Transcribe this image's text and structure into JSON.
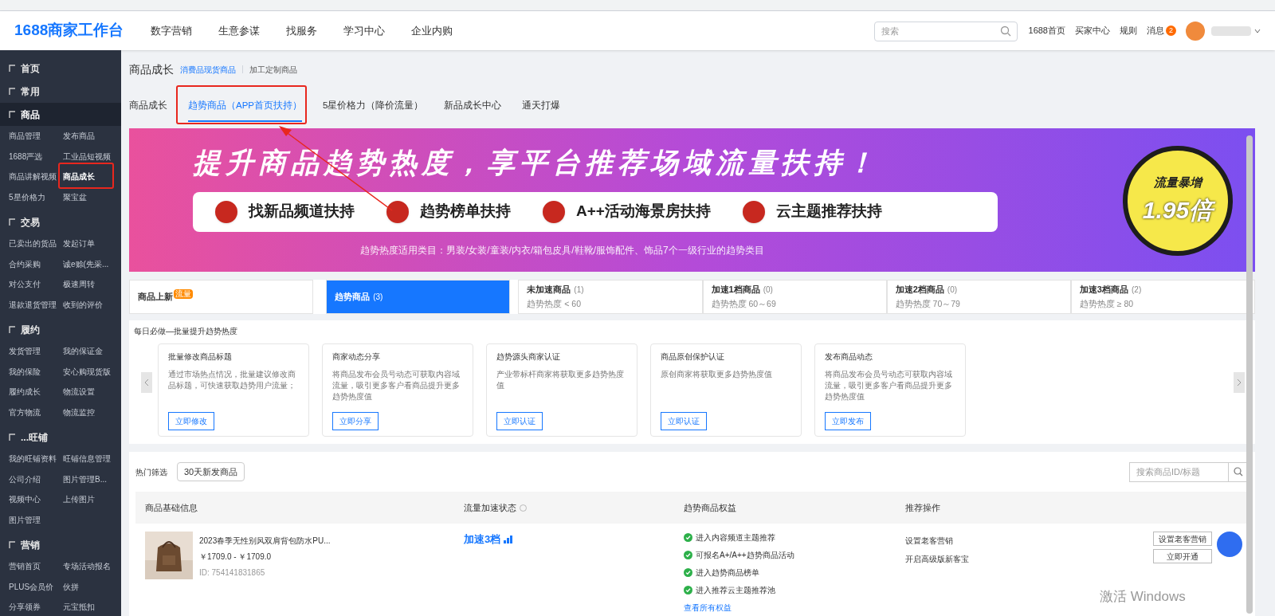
{
  "header": {
    "logo": "1688商家工作台",
    "nav": [
      "数字营销",
      "生意参谋",
      "找服务",
      "学习中心",
      "企业内购"
    ],
    "search": {
      "placeholder": "搜索"
    },
    "links": [
      "1688首页",
      "买家中心",
      "规则"
    ],
    "messages": {
      "label": "消息",
      "count": "2"
    }
  },
  "sidebar": {
    "sections": [
      {
        "title": "首页",
        "selected": false
      },
      {
        "title": "常用",
        "selected": false
      },
      {
        "title": "商品",
        "selected": true,
        "items": [
          {
            "label": "商品管理",
            "selected": false
          },
          {
            "label": "发布商品",
            "selected": false
          },
          {
            "label": "1688严选",
            "selected": false
          },
          {
            "label": "工业品短视频",
            "selected": false
          },
          {
            "label": "商品讲解视频",
            "selected": false
          },
          {
            "label": "商品成长",
            "selected": true
          },
          {
            "label": "5星价格力",
            "selected": false
          },
          {
            "label": "聚宝盆",
            "selected": false
          }
        ]
      },
      {
        "title": "交易",
        "selected": false,
        "items": [
          {
            "label": "已卖出的货品",
            "selected": false
          },
          {
            "label": "发起订单",
            "selected": false
          },
          {
            "label": "合约采购",
            "selected": false
          },
          {
            "label": "诚e赊(先采...",
            "selected": false
          },
          {
            "label": "对公支付",
            "selected": false
          },
          {
            "label": "极速周转",
            "selected": false
          },
          {
            "label": "退款退货管理",
            "selected": false
          },
          {
            "label": "收到的评价",
            "selected": false
          }
        ]
      },
      {
        "title": "履约",
        "selected": false,
        "items": [
          {
            "label": "发货管理",
            "selected": false
          },
          {
            "label": "我的保证金",
            "selected": false
          },
          {
            "label": "我的保险",
            "selected": false
          },
          {
            "label": "安心购现货版",
            "selected": false
          },
          {
            "label": "履约成长",
            "selected": false
          },
          {
            "label": "物流设置",
            "selected": false
          },
          {
            "label": "官方物流",
            "selected": false
          },
          {
            "label": "物流监控",
            "selected": false
          }
        ]
      },
      {
        "title": "...旺铺",
        "selected": false,
        "items": [
          {
            "label": "我的旺铺资料",
            "selected": false
          },
          {
            "label": "旺铺信息管理",
            "selected": false
          },
          {
            "label": "公司介绍",
            "selected": false
          },
          {
            "label": "图片管理B...",
            "selected": false
          },
          {
            "label": "视频中心",
            "selected": false
          },
          {
            "label": "上传图片",
            "selected": false
          },
          {
            "label": "图片管理",
            "selected": false
          }
        ]
      },
      {
        "title": "营销",
        "selected": false,
        "items": [
          {
            "label": "营销首页",
            "selected": false
          },
          {
            "label": "专场活动报名",
            "selected": false
          },
          {
            "label": "PLUS会员价",
            "selected": false
          },
          {
            "label": "伙拼",
            "selected": false
          },
          {
            "label": "分享领券",
            "selected": false
          },
          {
            "label": "元宝抵扣",
            "selected": false
          }
        ]
      }
    ]
  },
  "breadcrumb": {
    "title": "商品成长",
    "links": [
      {
        "label": "消费品现货商品",
        "selected": true
      },
      {
        "label": "加工定制商品",
        "selected": false
      }
    ]
  },
  "tabs": [
    {
      "label": "商品成长",
      "selected": false
    },
    {
      "label": "趋势商品（APP首页扶持）",
      "selected": true
    },
    {
      "label": "5星价格力（降价流量）",
      "selected": false
    },
    {
      "label": "新品成长中心",
      "selected": false
    },
    {
      "label": "通天打爆",
      "selected": false
    }
  ],
  "banner": {
    "headline": "提升商品趋势热度，享平台推荐场域流量扶持！",
    "pills": [
      "找新品频道扶持",
      "趋势榜单扶持",
      "A++活动海景房扶持",
      "云主题推荐扶持"
    ],
    "note": "趋势热度适用类目：男装/女装/童装/内衣/箱包皮具/鞋靴/服饰配件、饰品7个一级行业的趋势类目",
    "badge": {
      "top": "流量暴增",
      "value": "1.95倍"
    }
  },
  "stages": [
    {
      "label": "商品上新",
      "badge": "流量",
      "selected": false
    },
    {
      "label": "趋势商品",
      "count": "(3)",
      "selected": true
    },
    {
      "label": "未加速商品",
      "count": "(1)",
      "range": "趋势热度 < 60",
      "selected": false
    },
    {
      "label": "加速1档商品",
      "count": "(0)",
      "range": "趋势热度 60～69",
      "selected": false
    },
    {
      "label": "加速2档商品",
      "count": "(0)",
      "range": "趋势热度 70～79",
      "selected": false
    },
    {
      "label": "加速3档商品",
      "count": "(2)",
      "range": "趋势热度 ≥ 80",
      "selected": false
    }
  ],
  "daily": {
    "title": "每日必做—批量提升趋势热度",
    "cards": [
      {
        "title": "批量修改商品标题",
        "desc": "通过市场热点情况，批量建议修改商品标题，可快速获取趋势用户流量；",
        "button": "立即修改"
      },
      {
        "title": "商家动态分享",
        "desc": "将商品发布会员号动态可获取内容域流量，吸引更多客户看商品提升更多趋势热度值",
        "button": "立即分享"
      },
      {
        "title": "趋势源头商家认证",
        "desc": "产业带标杆商家将获取更多趋势热度值",
        "button": "立即认证"
      },
      {
        "title": "商品原创保护认证",
        "desc": "原创商家将获取更多趋势热度值",
        "button": "立即认证"
      },
      {
        "title": "发布商品动态",
        "desc": "将商品发布会员号动态可获取内容域流量，吸引更多客户看商品提升更多趋势热度值",
        "button": "立即发布"
      }
    ]
  },
  "filter": {
    "label": "热门筛选",
    "chip": "30天新发商品",
    "search": {
      "placeholder": "搜索商品ID/标题"
    }
  },
  "table": {
    "columns": [
      "商品基础信息",
      "流量加速状态",
      "趋势商品权益",
      "推荐操作"
    ],
    "rows": [
      {
        "title": "2023春季无性别风双肩背包防水PU...",
        "price": "￥1709.0 - ￥1709.0",
        "id": "ID: 754141831865",
        "status": "加速3档",
        "benefits": [
          "进入内容频道主题推荐",
          "可报名A+/A++趋势商品活动",
          "进入趋势商品榜单",
          "进入推荐云主题推荐池"
        ],
        "benefits_link": "查看所有权益",
        "actions": [
          "设置老客营销",
          "开启高级版新客宝"
        ],
        "buttons": [
          "设置老客营销",
          "立即开通"
        ]
      }
    ]
  },
  "os_notice": "激活 Windows"
}
